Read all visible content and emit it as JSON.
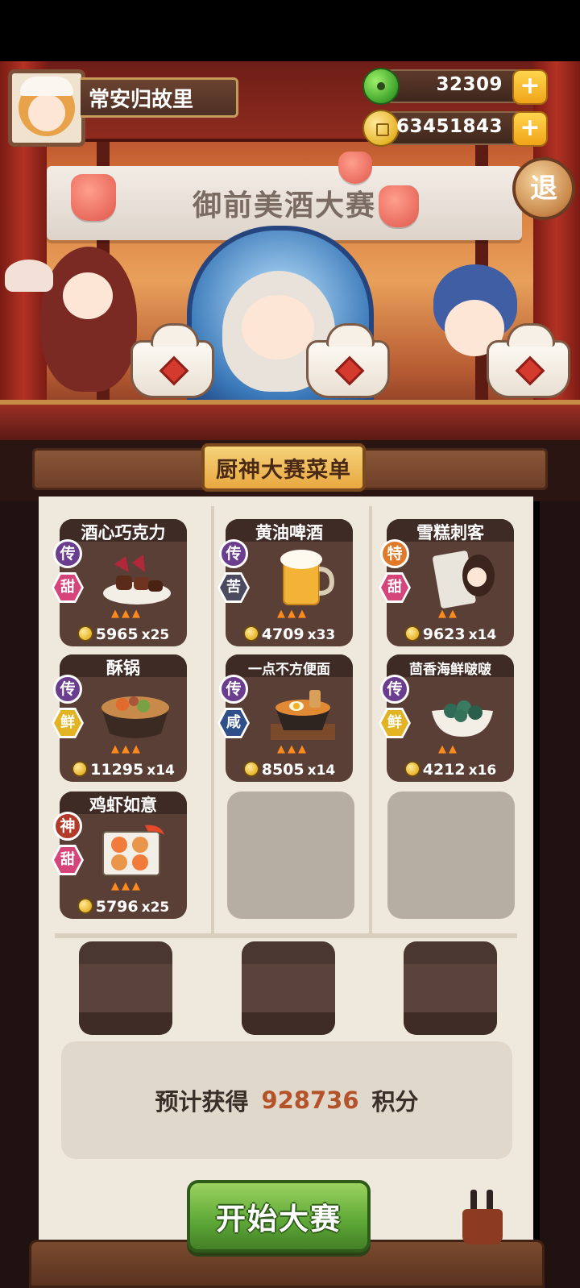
{
  "player": {
    "name": "常安归故里",
    "avatar_icon": "chef-girl-avatar-icon"
  },
  "currency": {
    "gems": {
      "amount": "32309",
      "icon": "jade-gem-icon",
      "add_label": "+"
    },
    "coins": {
      "amount": "63451843",
      "icon": "gold-coin-icon",
      "add_label": "+"
    }
  },
  "exit_button": {
    "label": "退"
  },
  "banner": {
    "title": "御前美酒大赛"
  },
  "menu": {
    "title": "厨神大赛菜单"
  },
  "dishes": [
    {
      "name": "酒心巧克力",
      "rank": "传",
      "rank_color": "#6a3d8f",
      "flavor": "甜",
      "flavor_color": "#d6457a",
      "price": "5965",
      "qty": "x25",
      "food_icon": "chocolate-icon"
    },
    {
      "name": "黄油啤酒",
      "rank": "传",
      "rank_color": "#6a3d8f",
      "flavor": "苦",
      "flavor_color": "#4b4a5e",
      "price": "4709",
      "qty": "x33",
      "food_icon": "beer-icon"
    },
    {
      "name": "雪糕刺客",
      "rank": "特",
      "rank_color": "#e07a28",
      "flavor": "甜",
      "flavor_color": "#d6457a",
      "price": "9623",
      "qty": "x14",
      "food_icon": "ice-cream-icon"
    },
    {
      "name": "酥锅",
      "rank": "传",
      "rank_color": "#6a3d8f",
      "flavor": "鲜",
      "flavor_color": "#e2b322",
      "price": "11295",
      "qty": "x14",
      "food_icon": "stew-pot-icon"
    },
    {
      "name": "一点不方便面",
      "rank": "传",
      "rank_color": "#6a3d8f",
      "flavor": "咸",
      "flavor_color": "#2f4f8a",
      "price": "8505",
      "qty": "x14",
      "food_icon": "noodle-bowl-icon"
    },
    {
      "name": "茴香海鲜啵啵",
      "rank": "传",
      "rank_color": "#6a3d8f",
      "flavor": "鲜",
      "flavor_color": "#e2b322",
      "price": "4212",
      "qty": "x16",
      "food_icon": "seafood-bowl-icon"
    },
    {
      "name": "鸡虾如意",
      "rank": "神",
      "rank_color": "#b23a28",
      "flavor": "甜",
      "flavor_color": "#d6457a",
      "price": "5796",
      "qty": "x25",
      "food_icon": "shrimp-platter-icon"
    }
  ],
  "estimate": {
    "label": "预计获得",
    "value": "928736",
    "unit": "积分"
  },
  "start_button": {
    "label": "开始大赛"
  }
}
